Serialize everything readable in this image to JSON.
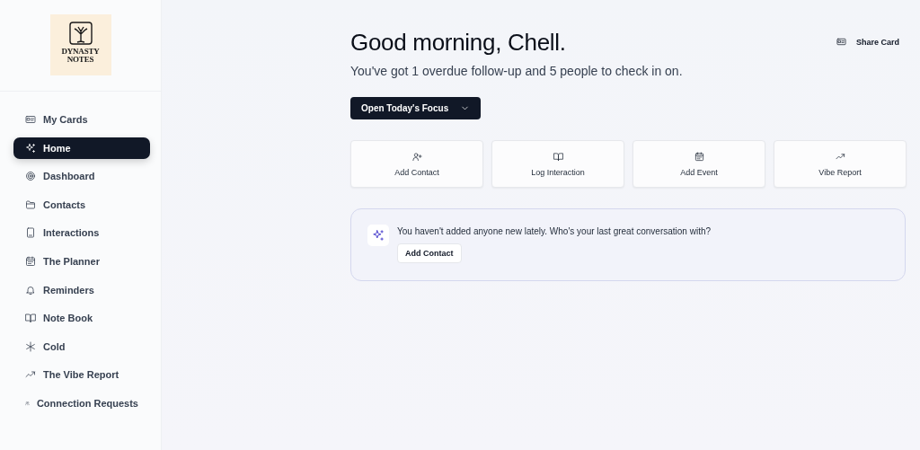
{
  "sidebar": {
    "logo": {
      "line_1": "DYNASTY",
      "line_2": "NOTES"
    },
    "items": [
      {
        "label": "My Cards",
        "selected": false
      },
      {
        "label": "Home",
        "selected": true
      },
      {
        "label": "Dashboard",
        "selected": false
      },
      {
        "label": "Contacts",
        "selected": false
      },
      {
        "label": "Interactions",
        "selected": false
      },
      {
        "label": "The Planner",
        "selected": false
      },
      {
        "label": "Reminders",
        "selected": false
      },
      {
        "label": "Note Book",
        "selected": false
      },
      {
        "label": "Cold",
        "selected": false
      },
      {
        "label": "The Vibe Report",
        "selected": false
      },
      {
        "label": "Connection Requests",
        "selected": false
      }
    ]
  },
  "header": {
    "greeting": "Good morning, Chell.",
    "summary": "You've got 1 overdue follow-up and 5 people to check in on.",
    "share_button": "Share Card"
  },
  "focus_button": "Open Today's Focus",
  "quick_actions": [
    "Add Contact",
    "Log Interaction",
    "Add Event",
    "Vibe Report"
  ],
  "prompt": {
    "message": "You haven't added anyone new lately. Who's your last great conversation with?",
    "button": "Add Contact"
  }
}
